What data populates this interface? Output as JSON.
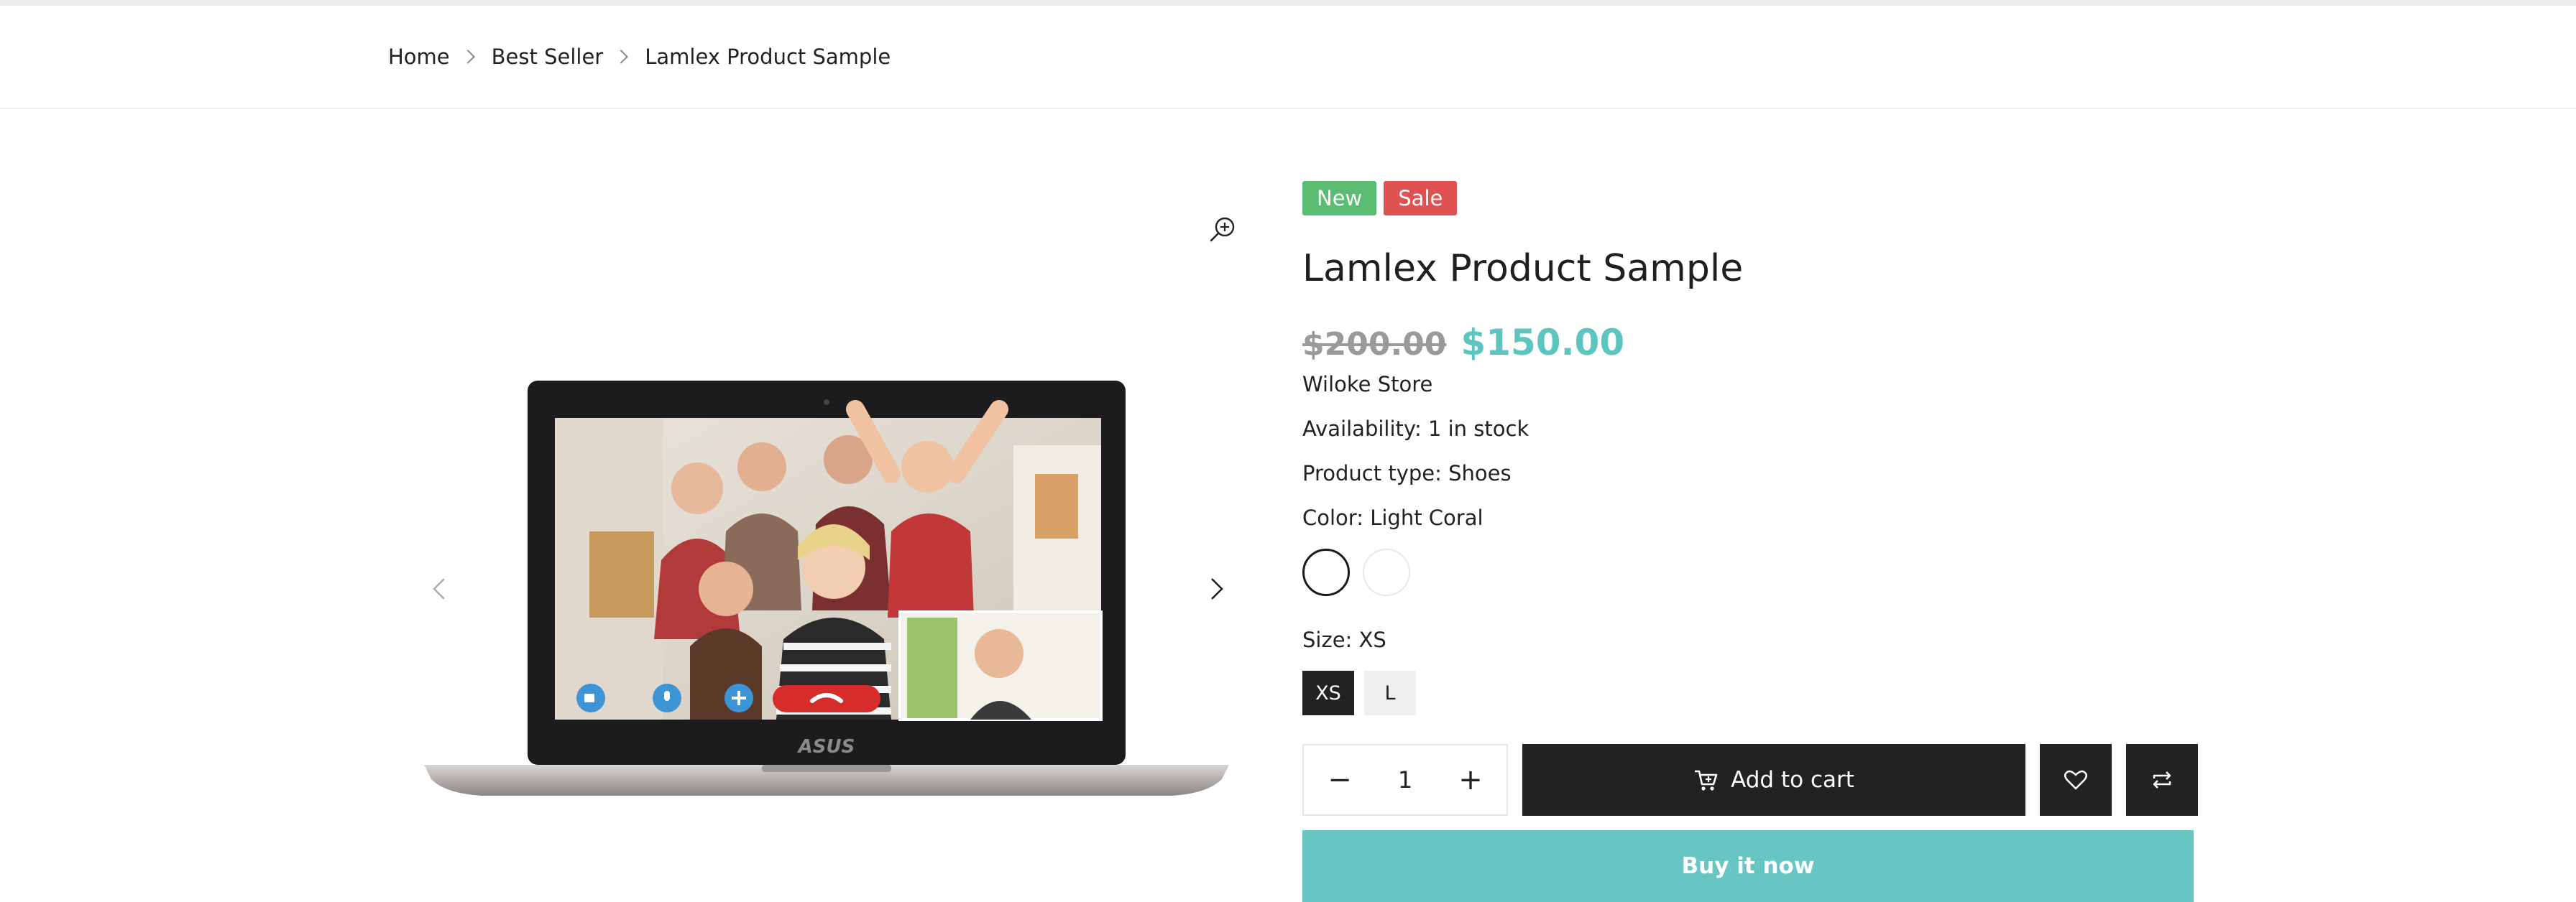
{
  "breadcrumb": {
    "items": [
      "Home",
      "Best Seller",
      "Lamlex Product Sample"
    ]
  },
  "gallery": {
    "zoom_icon": "zoom-in-icon",
    "prev_icon": "chevron-left-icon",
    "next_icon": "chevron-right-icon",
    "screen_brand": "ASUS"
  },
  "product": {
    "badges": [
      {
        "label": "New",
        "color": "#5bbd72"
      },
      {
        "label": "Sale",
        "color": "#e05252"
      }
    ],
    "title": "Lamlex Product Sample",
    "old_price": "$200.00",
    "new_price": "$150.00",
    "vendor": "Wiloke Store",
    "availability": "Availability: 1 in stock",
    "product_type": "Product type: Shoes",
    "color_label": "Color: Light Coral",
    "size_label": "Size: XS",
    "sizes": [
      "XS",
      "L"
    ],
    "quantity": "1",
    "add_to_cart_label": "Add to cart",
    "buy_now_label": "Buy it now"
  },
  "colors": {
    "accent": "#5ec4c0",
    "buy_now_bg": "#67c6c1",
    "dark_button": "#222222"
  }
}
